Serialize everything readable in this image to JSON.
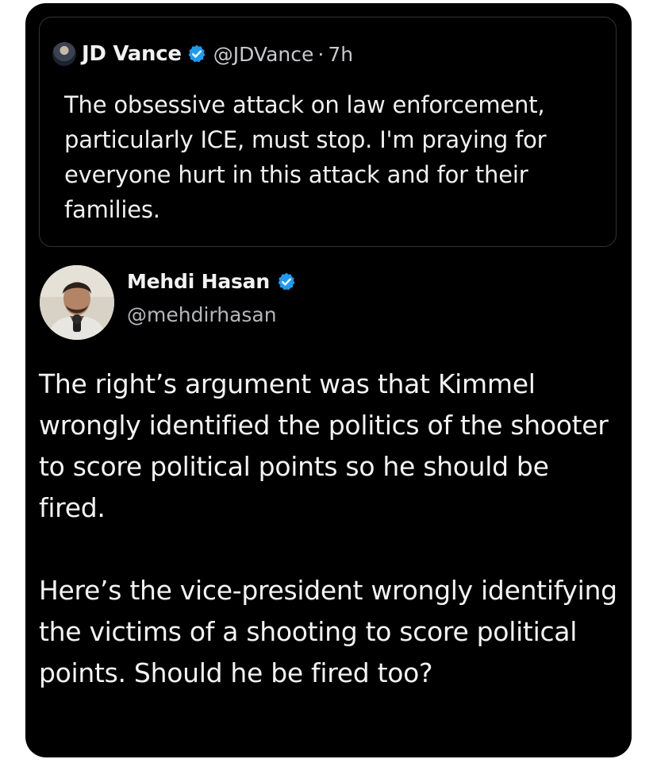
{
  "colors": {
    "background": "#000000",
    "text": "#f3f3f3",
    "secondary_text": "#b4b7ba",
    "verified_badge": "#1d9bf0",
    "card_border": "#2f3336"
  },
  "quoted_post": {
    "avatar_icon": "avatar-icon",
    "author_name": "JD Vance",
    "verified_icon": "verified-badge-icon",
    "handle": "@JDVance",
    "separator": "·",
    "time": "7h",
    "text": "The obsessive attack on law enforcement, particularly ICE, must stop. I'm praying for everyone hurt in this attack and for their families."
  },
  "post": {
    "avatar_icon": "avatar-icon",
    "author_name": "Mehdi Hasan",
    "verified_icon": "verified-badge-icon",
    "handle": "@mehdirhasan",
    "paragraphs": [
      "The right’s argument was that Kimmel wrongly identified the politics of the shooter to score political points so he should be fired.",
      "Here’s the vice-president wrongly identifying the victims of a shooting to score political points. Should he be fired too?"
    ]
  }
}
